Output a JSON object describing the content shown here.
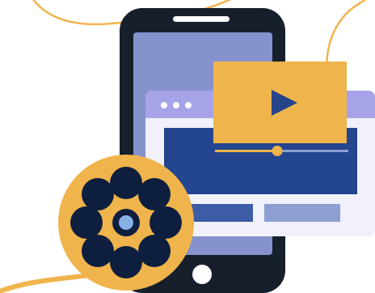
{
  "illustration": {
    "subject": "",
    "colors": {
      "accent": "#F0B44C",
      "phone_body": "#161F2B",
      "phone_screen": "#8592CC",
      "browser_window": "#F0F1FA",
      "browser_titlebar": "#A6A3E8",
      "browser_content": "#24458F",
      "player_panel": "#F0B44C",
      "play_button": "#26448A",
      "block_dark": "#3C5DA6",
      "block_light": "#8D9FD1",
      "reel_hole": "#0E1E3E",
      "hub": "#86B2E4"
    },
    "icons": [
      "play-icon",
      "film-reel-icon",
      "smartphone-icon",
      "browser-window-icon"
    ]
  }
}
